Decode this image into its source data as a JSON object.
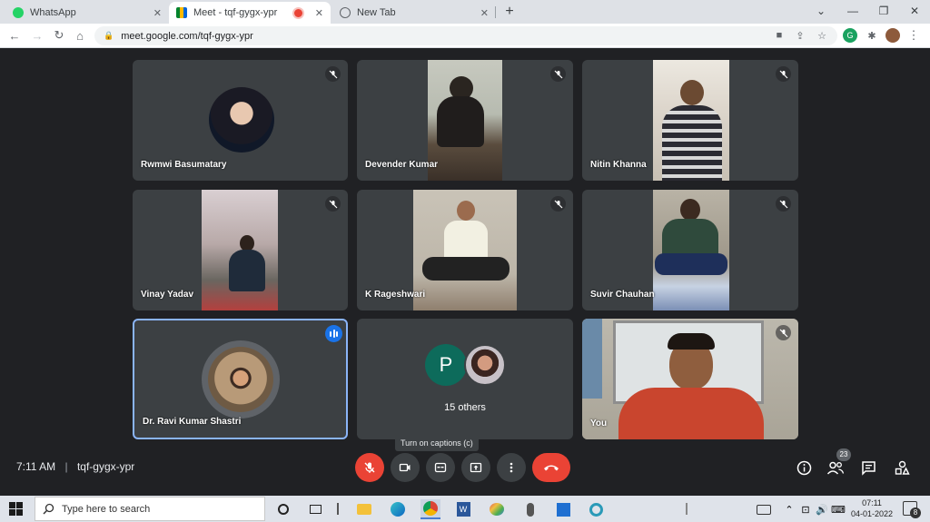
{
  "browser": {
    "tabs": [
      {
        "title": "WhatsApp",
        "favicon": "whatsapp-icon"
      },
      {
        "title": "Meet - tqf-gygx-ypr",
        "favicon": "google-meet-icon",
        "recording": true
      },
      {
        "title": "New Tab",
        "favicon": "globe-icon"
      }
    ],
    "url": "meet.google.com/tqf-gygx-ypr"
  },
  "meet": {
    "participants": [
      {
        "name": "Rwmwi Basumatary",
        "muted": true
      },
      {
        "name": "Devender Kumar",
        "muted": true
      },
      {
        "name": "Nitin Khanna",
        "muted": true
      },
      {
        "name": "Vinay Yadav",
        "muted": true
      },
      {
        "name": "K Rageshwari",
        "muted": true
      },
      {
        "name": "Suvir Chauhan",
        "muted": true
      },
      {
        "name": "Dr. Ravi Kumar Shastri",
        "speaking": true
      },
      {
        "name": "You",
        "muted": true
      }
    ],
    "others": {
      "initial": "P",
      "label": "15 others"
    },
    "tooltip": "Turn on captions (c)",
    "time": "7:11 AM",
    "meeting_code": "tqf-gygx-ypr",
    "people_count": "23",
    "colors": {
      "background": "#202124",
      "tile": "#3c4043",
      "end_call": "#ea4335",
      "speaking_border": "#8ab4f8",
      "p_avatar": "#0d6b5b"
    }
  },
  "taskbar": {
    "search_placeholder": "Type here to search",
    "clock_time": "07:11",
    "clock_date": "04-01-2022",
    "notification_count": "8"
  }
}
